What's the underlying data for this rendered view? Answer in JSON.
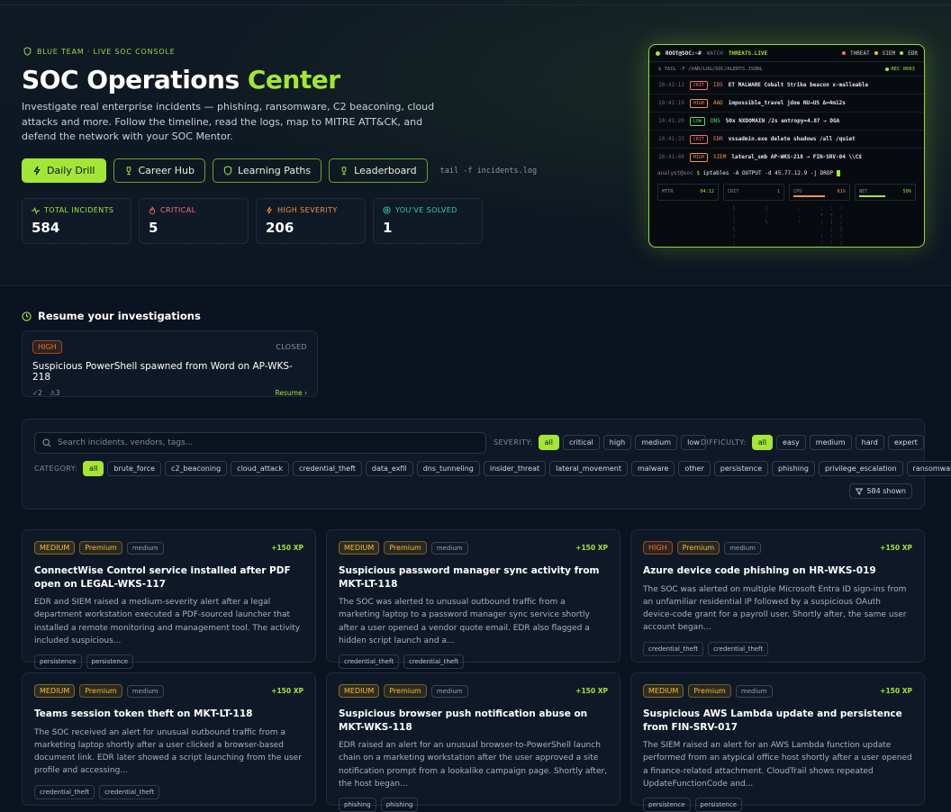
{
  "hero": {
    "eyebrow": "BLUE TEAM · LIVE SOC CONSOLE",
    "title_main": "SOC Operations ",
    "title_accent": "Center",
    "description": "Investigate real enterprise incidents — phishing, ransomware, C2 beaconing, cloud attacks and more. Follow the timeline, read the logs, map to MITRE ATT&CK, and defend the network with your SOC Mentor.",
    "buttons": {
      "daily": "Daily Drill",
      "career": "Career Hub",
      "paths": "Learning Paths",
      "leaderboard": "Leaderboard"
    },
    "tail_cmd": "tail -f incidents.log"
  },
  "stats": [
    {
      "label": "TOTAL INCIDENTS",
      "value": "584",
      "color": "#a3e635"
    },
    {
      "label": "CRITICAL",
      "value": "5",
      "color": "#f87171"
    },
    {
      "label": "HIGH SEVERITY",
      "value": "206",
      "color": "#fb923c"
    },
    {
      "label": "YOU'VE SOLVED",
      "value": "1",
      "color": "#34d399"
    }
  ],
  "terminal": {
    "prompt": "ROOT@SOC:~#",
    "watch": "WATCH",
    "feed": "THREATS.LIVE",
    "legend": [
      "THREAT",
      "SIEM",
      "EDR"
    ],
    "tail_path": "$ TAIL -F /VAR/LOG/SOC/ALERTS.JSONL",
    "rec": "REC 0003",
    "logs": [
      {
        "time": "10:41:11",
        "sev": "CRIT",
        "src": "IDS",
        "msg": "ET MALWARE Cobalt Strike beacon x-malleable",
        "color": "#f87171"
      },
      {
        "time": "10:41:19",
        "sev": "HIGH",
        "src": "AAD",
        "msg": "impossible_travel jdoe NU→US Δ=4m12s",
        "color": "#fb923c"
      },
      {
        "time": "10:41:20",
        "sev": "LOW",
        "src": "DNS",
        "msg": "50x NXDOMAIN /2s entropy=4.87 → DGA",
        "color": "#4ade80"
      },
      {
        "time": "10:41:33",
        "sev": "CRIT",
        "src": "EDR",
        "msg": "vssadmin.exe delete shadows /all /quiet",
        "color": "#f87171"
      },
      {
        "time": "10:41:40",
        "sev": "HIGH",
        "src": "SIEM",
        "msg": "lateral_smb AP-WKS-218 → FIN-SRV-04 \\\\C$",
        "color": "#fb923c"
      }
    ],
    "cmd_user": "analyst@soc",
    "cmd": "iptables -A OUTPUT -d 45.77.12.9 -j DROP",
    "meters": [
      {
        "label": "MTTR",
        "value": "04:12",
        "fill": 0,
        "color": "#a3e635"
      },
      {
        "label": "CRIT",
        "value": "1",
        "fill": 0,
        "color": "#f87171"
      },
      {
        "label": "CPU",
        "value": "61%",
        "fill": 0.61,
        "color": "#fb923c"
      },
      {
        "label": "NET",
        "value": "50%",
        "fill": 0.5,
        "color": "#a3e635"
      }
    ]
  },
  "resume": {
    "heading": "Resume your investigations",
    "card": {
      "severity": "HIGH",
      "status": "CLOSED",
      "title": "Suspicious PowerShell spawned from Word on AP-WKS-218",
      "checks": "✓2",
      "alerts": "⚠3",
      "action": "Resume"
    }
  },
  "filters": {
    "search_placeholder": "Search incidents, vendors, tags...",
    "severity_label": "SEVERITY:",
    "severity": [
      "all",
      "critical",
      "high",
      "medium",
      "low"
    ],
    "difficulty_label": "DIFFICULTY:",
    "difficulty": [
      "all",
      "easy",
      "medium",
      "hard",
      "expert"
    ],
    "category_label": "CATEGORY:",
    "categories": [
      "all",
      "brute_force",
      "c2_beaconing",
      "cloud_attack",
      "credential_theft",
      "data_exfil",
      "dns_tunneling",
      "insider_threat",
      "lateral_movement",
      "malware",
      "other",
      "persistence",
      "phishing",
      "privilege_escalation",
      "ransomware"
    ],
    "shown": "584 shown"
  },
  "cards": [
    {
      "sev": "MEDIUM",
      "tier": "Premium",
      "diff": "medium",
      "xp": "+150 XP",
      "title": "ConnectWise Control service installed after PDF open on LEGAL-WKS-117",
      "body": "EDR and SIEM raised a medium-severity alert after a legal department workstation executed a PDF-sourced launcher that installed a remote monitoring and management tool. The activity included suspicious...",
      "tags": [
        "persistence",
        "persistence"
      ]
    },
    {
      "sev": "MEDIUM",
      "tier": "Premium",
      "diff": "medium",
      "xp": "+150 XP",
      "title": "Suspicious password manager sync activity from MKT-LT-118",
      "body": "The SOC was alerted to unusual outbound traffic from a marketing laptop to a password manager sync service shortly after a user opened a vendor quote email. EDR also flagged a hidden script launch and a...",
      "tags": [
        "credential_theft",
        "credential_theft"
      ]
    },
    {
      "sev": "HIGH",
      "tier": "Premium",
      "diff": "medium",
      "xp": "+150 XP",
      "title": "Azure device code phishing on HR-WKS-019",
      "body": "The SOC was alerted on multiple Microsoft Entra ID sign-ins from an unfamiliar residential IP followed by a suspicious OAuth device-code grant for a payroll user. Shortly after, the same user account began...",
      "tags": [
        "credential_theft",
        "credential_theft"
      ]
    },
    {
      "sev": "MEDIUM",
      "tier": "Premium",
      "diff": "medium",
      "xp": "+150 XP",
      "title": "Teams session token theft on MKT-LT-118",
      "body": "The SOC received an alert for unusual outbound traffic from a marketing laptop shortly after a user clicked a browser-based document link. EDR later showed a script launching from the user profile and accessing...",
      "tags": [
        "credential_theft",
        "credential_theft"
      ]
    },
    {
      "sev": "MEDIUM",
      "tier": "Premium",
      "diff": "medium",
      "xp": "+150 XP",
      "title": "Suspicious browser push notification abuse on MKT-WKS-118",
      "body": "EDR raised an alert for an unusual browser-to-PowerShell launch chain on a marketing workstation after the user approved a site notification prompt from a lookalike campaign page. Shortly after, the host began...",
      "tags": [
        "phishing",
        "phishing"
      ]
    },
    {
      "sev": "MEDIUM",
      "tier": "Premium",
      "diff": "medium",
      "xp": "+150 XP",
      "title": "Suspicious AWS Lambda update and persistence from FIN-SRV-017",
      "body": "The SIEM raised an alert for an AWS Lambda function update performed from an atypical office host shortly after a user opened a finance-related attachment. CloudTrail shows repeated UpdateFunctionCode and...",
      "tags": [
        "persistence",
        "persistence"
      ]
    }
  ]
}
